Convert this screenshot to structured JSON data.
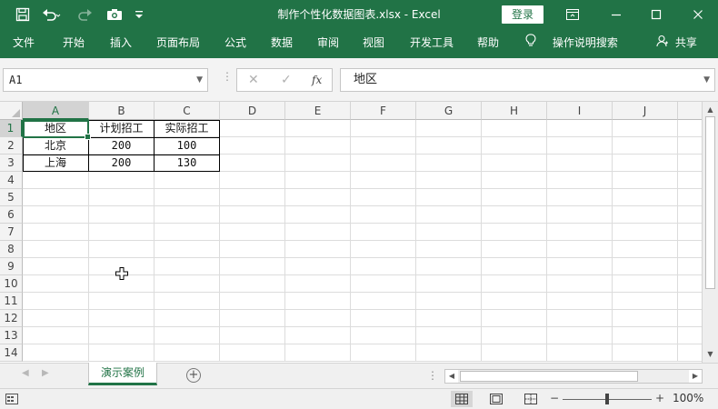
{
  "titlebar": {
    "title": "制作个性化数据图表.xlsx  -  Excel",
    "login_label": "登录",
    "quick_access": [
      "save-icon",
      "undo-icon",
      "redo-icon",
      "camera-icon",
      "customize-icon"
    ],
    "window_buttons": [
      "ribbon-display-icon",
      "minimize-icon",
      "maximize-icon",
      "close-icon"
    ],
    "brand_color": "#217346"
  },
  "ribbon": {
    "tabs": [
      "文件",
      "开始",
      "插入",
      "页面布局",
      "公式",
      "数据",
      "审阅",
      "视图",
      "开发工具",
      "帮助"
    ],
    "tell_me": "操作说明搜索",
    "share": "共享"
  },
  "formula_bar": {
    "name_box": "A1",
    "cancel": "✕",
    "enter": "✓",
    "fx": "fx",
    "content": "地区"
  },
  "sheet": {
    "columns": [
      "A",
      "B",
      "C",
      "D",
      "E",
      "F",
      "G",
      "H",
      "I",
      "J"
    ],
    "rows": [
      "1",
      "2",
      "3",
      "4",
      "5",
      "6",
      "7",
      "8",
      "9",
      "10",
      "11",
      "12",
      "13",
      "14"
    ],
    "cells": [
      [
        "地区",
        "计划招工",
        "实际招工"
      ],
      [
        "北京",
        "200",
        "100"
      ],
      [
        "上海",
        "200",
        "130"
      ]
    ],
    "active_cell": "A1"
  },
  "sheet_tabs": {
    "active": "演示案例"
  },
  "status": {
    "zoom": "100%",
    "zoom_minus": "−",
    "zoom_plus": "+",
    "ellipsis": "⋮",
    "views": [
      "normal-view-icon",
      "page-layout-view-icon",
      "page-break-view-icon"
    ]
  }
}
